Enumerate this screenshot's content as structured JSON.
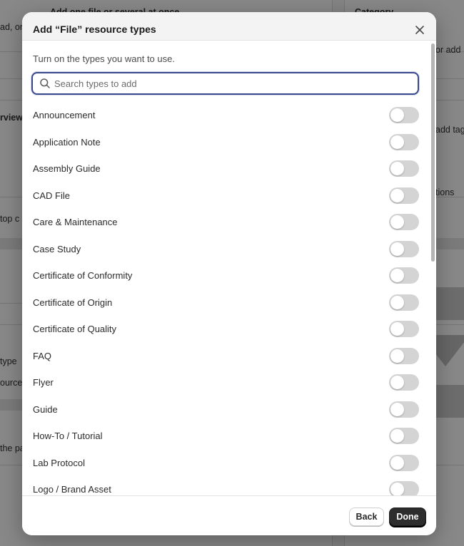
{
  "background": {
    "left_texts": [
      {
        "text": "Add one file or several at once",
        "bold": true
      },
      {
        "text": "ad, or",
        "bold": false
      },
      {
        "text": "rview",
        "bold": true
      },
      {
        "text": "top c",
        "bold": false
      },
      {
        "text": "type",
        "bold": false
      },
      {
        "text": "ource",
        "bold": false
      },
      {
        "text": "the pa",
        "bold": false
      }
    ],
    "right_texts": [
      {
        "text": "Category",
        "bold": true
      },
      {
        "text": "or add",
        "bold": false
      },
      {
        "text": "add tag",
        "bold": false
      },
      {
        "text": "tions",
        "bold": false
      }
    ]
  },
  "modal": {
    "title": "Add “File” resource types",
    "subtitle": "Turn on the types you want to use.",
    "search": {
      "placeholder": "Search types to add",
      "value": ""
    },
    "types": [
      {
        "label": "Announcement",
        "enabled": false
      },
      {
        "label": "Application Note",
        "enabled": false
      },
      {
        "label": "Assembly Guide",
        "enabled": false
      },
      {
        "label": "CAD File",
        "enabled": false
      },
      {
        "label": "Care & Maintenance",
        "enabled": false
      },
      {
        "label": "Case Study",
        "enabled": false
      },
      {
        "label": "Certificate of Conformity",
        "enabled": false
      },
      {
        "label": "Certificate of Origin",
        "enabled": false
      },
      {
        "label": "Certificate of Quality",
        "enabled": false
      },
      {
        "label": "FAQ",
        "enabled": false
      },
      {
        "label": "Flyer",
        "enabled": false
      },
      {
        "label": "Guide",
        "enabled": false
      },
      {
        "label": "How-To / Tutorial",
        "enabled": false
      },
      {
        "label": "Lab Protocol",
        "enabled": false
      },
      {
        "label": "Logo / Brand Asset",
        "enabled": false
      }
    ],
    "footer": {
      "back_label": "Back",
      "done_label": "Done"
    }
  },
  "icons": {
    "close": "close-icon",
    "search": "search-icon"
  },
  "colors": {
    "focus_ring": "#3a4a8c",
    "toggle_off": "#d4d4d4",
    "primary_button": "#2e2e2e"
  }
}
